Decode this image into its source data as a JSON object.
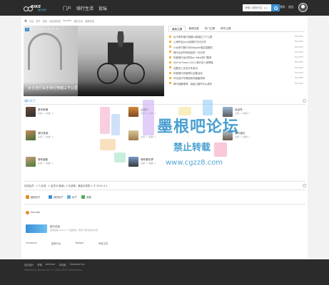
{
  "header": {
    "logo_text": "BIKE",
    "logo_sub": "骑行世界",
    "nav": [
      {
        "label": "门户"
      },
      {
        "label": "骑行生活"
      },
      {
        "label": "论坛"
      }
    ],
    "search": {
      "placeholder": "请输入搜索内容",
      "scope": "帖子"
    },
    "username": "我的",
    "user_link": "退出"
  },
  "breadcrumb": [
    "论坛",
    "帖子",
    "首页",
    "社区新动态",
    "founder",
    "我的主页",
    "最新动态"
  ],
  "slider": {
    "pages": [
      "1",
      "2",
      "3",
      "4",
      "5",
      "6",
      "7",
      "8"
    ],
    "active_page": "1",
    "caption": "女子自行车手骑行穿越三千公里"
  },
  "top_tabs": [
    "最新主题",
    "最新回复",
    "热门主题",
    "精华主题"
  ],
  "top_list": [
    {
      "title": "女子单车骑行穿越沙漠地区三千公里",
      "author": "founder"
    },
    {
      "title": "上海车友Joy山地骑行日记分享",
      "author": "founder"
    },
    {
      "title": "小伙伴们骑行去Kitagata湖边赏樱花",
      "author": "founder"
    },
    {
      "title": "骑行北京所有地标的一天分享",
      "author": "founder"
    },
    {
      "title": "年度骑行运动员Ben West热门推荐",
      "author": "founder"
    },
    {
      "title": "Half of Fame 2013 骑行名人堂揭晓",
      "author": "founder"
    },
    {
      "title": "北戴河三天自行车游记",
      "author": "founder"
    },
    {
      "title": "年度骑行风景照片征集活动",
      "author": "founder"
    },
    {
      "title": "环法自行车赛冠军的装备清单",
      "author": "founder"
    },
    {
      "title": "骑行装备推荐：高级公路车与山地车",
      "author": "founder"
    }
  ],
  "forums_title": "骑行天下",
  "forums": [
    {
      "name": "单车新闻",
      "stat": "主题: 1, 帖数: 1"
    },
    {
      "name": "骑行旅游",
      "stat": "主题: 1, 帖数: 1"
    },
    {
      "name": "公路车",
      "stat": "主题: 1, 帖数: 1"
    },
    {
      "name": "自由车",
      "stat": "主题: 1, 帖数: 1"
    },
    {
      "name": "",
      "stat": "主题: 1, 帖数: 1"
    },
    {
      "name": "骑车摄影",
      "stat": "主题: 1, 帖数: 1"
    },
    {
      "name": "骑车看世界",
      "stat": "主题: 1, 帖数: 1"
    },
    {
      "name": "骑行漫记",
      "stat": "主题: 1, 帖数: 1"
    }
  ],
  "stats_line": "在线会员 - 1 人在线 - 1 会员(0 隐身), 0 位游客 - 最高记录是 2 于 2014-3-1.",
  "user_blocks": [
    {
      "label": "最新帖子"
    },
    {
      "label": "我的帖子"
    },
    {
      "label": "帖子"
    },
    {
      "label": "收藏"
    }
  ],
  "founder_label": "founder",
  "official": {
    "name": "官方论坛",
    "desc": "提供最新 Discuz! 产品新闻、软件下载与技术交流"
  },
  "links": [
    "Comsenz",
    "漫游平台",
    "Yeswan",
    "专用主机"
  ],
  "footer": {
    "links": [
      "站点统计",
      "举报",
      "Archiver",
      "手机版",
      "Comsenz Inc."
    ],
    "copy": "Powered by Discuz! X3.1 © 2001-2013 Comsenz Inc."
  },
  "watermark": {
    "line1": "墨根吧论坛",
    "line2": "禁止转载",
    "line3": "www.cgzz8.com"
  },
  "colors": {
    "accent": "#3a8fd6",
    "topbar": "#2b2b2b"
  }
}
